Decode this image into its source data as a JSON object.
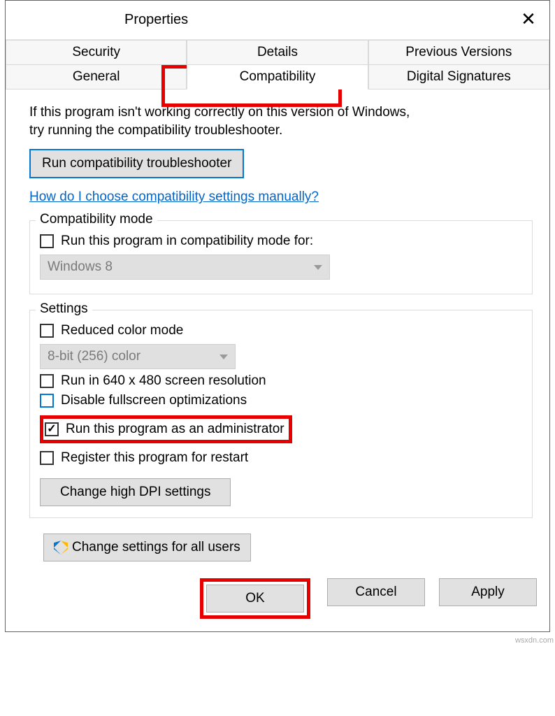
{
  "window": {
    "title": "Properties"
  },
  "tabs": {
    "row1": [
      "Security",
      "Details",
      "Previous Versions"
    ],
    "row2": [
      "General",
      "Compatibility",
      "Digital Signatures"
    ],
    "active": "Compatibility"
  },
  "intro": {
    "line1": "If this program isn't working correctly on this version of Windows,",
    "line2": "try running the compatibility troubleshooter."
  },
  "troubleshooter_btn": "Run compatibility troubleshooter",
  "help_link": "How do I choose compatibility settings manually?",
  "compat_mode": {
    "title": "Compatibility mode",
    "checkbox_label": "Run this program in compatibility mode for:",
    "checked": false,
    "selected_os": "Windows 8"
  },
  "settings": {
    "title": "Settings",
    "reduced_color": {
      "label": "Reduced color mode",
      "checked": false
    },
    "color_depth": "8-bit (256) color",
    "res_640": {
      "label": "Run in 640 x 480 screen resolution",
      "checked": false
    },
    "disable_fullscreen": {
      "label": "Disable fullscreen optimizations",
      "checked": false
    },
    "run_as_admin": {
      "label": "Run this program as an administrator",
      "checked": true
    },
    "register_restart": {
      "label": "Register this program for restart",
      "checked": false
    },
    "dpi_btn": "Change high DPI settings"
  },
  "all_users_btn": "Change settings for all users",
  "buttons": {
    "ok": "OK",
    "cancel": "Cancel",
    "apply": "Apply"
  },
  "watermark": "wsxdn.com"
}
